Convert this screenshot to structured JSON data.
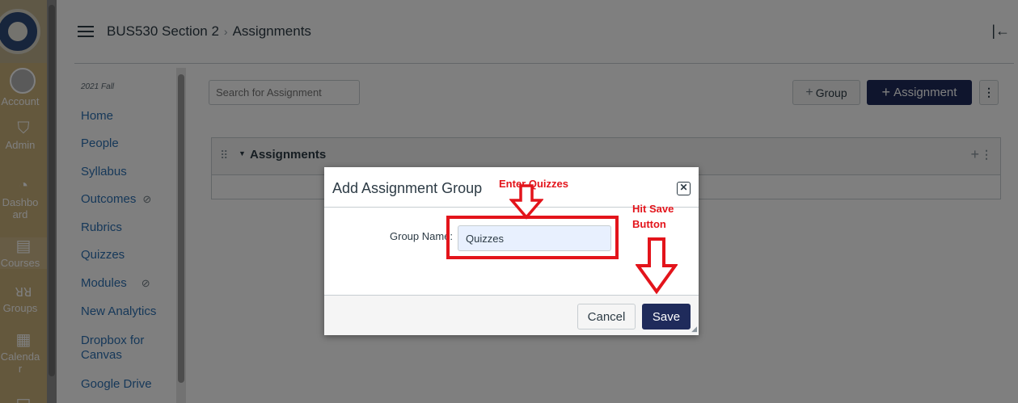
{
  "global_nav": {
    "items": [
      {
        "label": "Account",
        "icon": "avatar-icon"
      },
      {
        "label": "Admin",
        "icon": "shield-icon"
      },
      {
        "label": "Dashboard",
        "icon": "gauge-icon"
      },
      {
        "label": "Courses",
        "icon": "book-icon"
      },
      {
        "label": "Groups",
        "icon": "people-icon"
      },
      {
        "label": "Calendar",
        "icon": "calendar-icon"
      }
    ],
    "dashboard_lines": [
      "Dashbo",
      "ard"
    ],
    "calendar_lines": [
      "Calenda",
      "r"
    ]
  },
  "header": {
    "course": "BUS530 Section 2",
    "separator": "›",
    "page": "Assignments"
  },
  "course_nav": {
    "term": "2021 Fall",
    "items": [
      {
        "label": "Home",
        "hidden": false
      },
      {
        "label": "People",
        "hidden": false
      },
      {
        "label": "Syllabus",
        "hidden": false
      },
      {
        "label": "Outcomes",
        "hidden": true
      },
      {
        "label": "Rubrics",
        "hidden": false
      },
      {
        "label": "Quizzes",
        "hidden": false
      },
      {
        "label": "Modules",
        "hidden": true
      },
      {
        "label": "New Analytics",
        "hidden": false
      },
      {
        "label": "Dropbox for",
        "hidden": false
      },
      {
        "label": "Canvas",
        "hidden": false
      },
      {
        "label": "Google Drive",
        "hidden": false
      }
    ]
  },
  "toolbar": {
    "search_placeholder": "Search for Assignment",
    "group_label": "Group",
    "assignment_label": "Assignment",
    "plus": "+"
  },
  "assignment_group": {
    "title": "Assignments"
  },
  "dialog": {
    "title": "Add Assignment Group",
    "field_label": "Group Name:",
    "field_value": "Quizzes",
    "cancel_label": "Cancel",
    "save_label": "Save",
    "close_glyph": "✕"
  },
  "annotations": {
    "enter_note": "Enter Quizzes",
    "save_note_line1": "Hit Save",
    "save_note_line2": "Button",
    "color": "#e3141b"
  },
  "colors": {
    "nav_bg": "#c9b07a",
    "primary_button": "#1f2b5b",
    "link": "#2d70b3",
    "text": "#2d3b45"
  }
}
